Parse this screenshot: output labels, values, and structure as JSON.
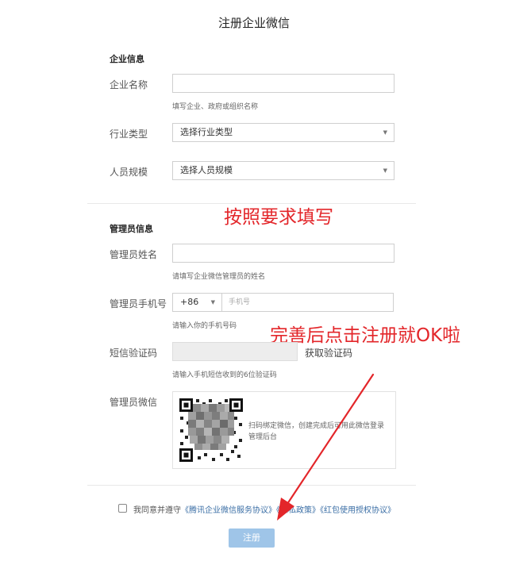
{
  "page_title": "注册企业微信",
  "company_section": {
    "title": "企业信息",
    "name_label": "企业名称",
    "name_value": "",
    "name_hint": "填写企业、政府或组织名称",
    "industry_label": "行业类型",
    "industry_value": "选择行业类型",
    "size_label": "人员规模",
    "size_value": "选择人员规模"
  },
  "admin_section": {
    "title": "管理员信息",
    "name_label": "管理员姓名",
    "name_value": "",
    "name_hint": "请填写企业微信管理员的姓名",
    "phone_label": "管理员手机号",
    "country_code": "+86",
    "phone_placeholder": "手机号",
    "phone_hint": "请输入你的手机号码",
    "sms_label": "短信验证码",
    "sms_value": "",
    "sms_button": "获取验证码",
    "sms_hint": "请输入手机短信收到的6位验证码",
    "wechat_label": "管理员微信",
    "qr_text": "扫码绑定微信，创建完成后可用此微信登录管理后台"
  },
  "annotations": {
    "fill_note": "按照要求填写",
    "submit_note": "完善后点击注册就OK啦"
  },
  "agreement": {
    "prefix": "我同意并遵守",
    "link1": "《腾讯企业微信服务协议》",
    "link2": "《隐私政策》",
    "link3": "《红包使用授权协议》"
  },
  "submit_label": "注册",
  "colors": {
    "annotation": "#e3262a",
    "button": "#9fc5e8",
    "link": "#3a6ea5"
  }
}
